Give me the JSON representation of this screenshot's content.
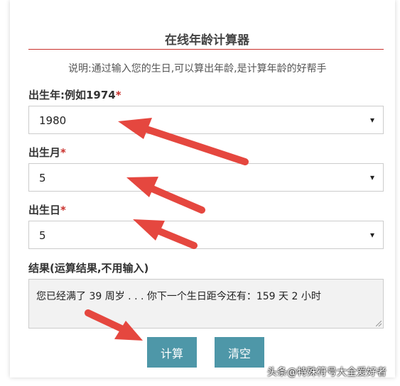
{
  "header": {
    "title": "在线年龄计算器",
    "description": "说明:通过输入您的生日,可以算出年龄,是计算年龄的好帮手"
  },
  "form": {
    "year": {
      "label": "出生年:例如1974",
      "required_mark": "*",
      "value": "1980"
    },
    "month": {
      "label": "出生月",
      "required_mark": "*",
      "value": "5"
    },
    "day": {
      "label": "出生日",
      "required_mark": "*",
      "value": "5"
    },
    "result": {
      "label": "结果(运算结果,不用输入)",
      "value": "您已经满了 39 周岁 . . . 你下一个生日距今还有：159 天 2 小时"
    }
  },
  "buttons": {
    "calculate": "计算",
    "clear": "清空"
  },
  "icons": {
    "select_caret": "▾"
  },
  "watermark": "头条@特殊符号大全爱好者",
  "colors": {
    "accent": "#4e97a8",
    "required": "#c9302c",
    "arrow": "#e5473f"
  }
}
